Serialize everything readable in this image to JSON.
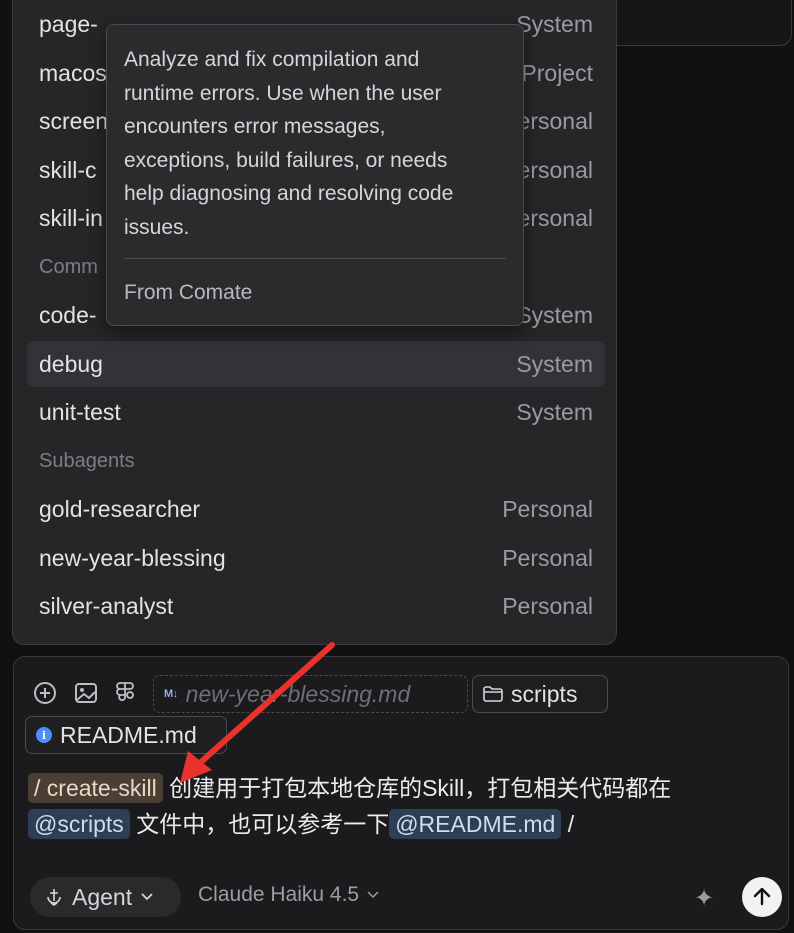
{
  "dropdown": {
    "rows_top": [
      {
        "name": "page-",
        "source": "System"
      },
      {
        "name": "macos",
        "source": "Project"
      },
      {
        "name": "screen",
        "source": "Personal"
      },
      {
        "name": "skill-c",
        "source": "Personal"
      },
      {
        "name": "skill-in",
        "source": "Personal"
      }
    ],
    "section_commands": "Comm",
    "commands": [
      {
        "name": "code-",
        "source": "System"
      },
      {
        "name": "debug",
        "source": "System"
      },
      {
        "name": "unit-test",
        "source": "System"
      }
    ],
    "section_subagents": "Subagents",
    "subagents": [
      {
        "name": "gold-researcher",
        "source": "Personal"
      },
      {
        "name": "new-year-blessing",
        "source": "Personal"
      },
      {
        "name": "silver-analyst",
        "source": "Personal"
      }
    ]
  },
  "tooltip": {
    "lines": [
      "Analyze and fix compilation and",
      "runtime errors. Use when the user",
      "encounters error messages,",
      "exceptions, build failures, or needs",
      "help diagnosing and resolving code",
      "issues."
    ],
    "from": "From Comate"
  },
  "composer": {
    "icons": [
      "add-circle-icon",
      "image-icon",
      "figma-icon"
    ],
    "context_chips": {
      "suggested_file": "new-year-blessing.md",
      "suggested_badge": "M↓",
      "folder": "scripts",
      "file": "README.md",
      "file_badge": "i"
    },
    "message": {
      "command": "/ create-skill",
      "text_1": "创建用于打包本地仓库的Skill，打包相关代码都在",
      "ref_1": "@scripts",
      "text_2": "文件中，也可以参考一下",
      "ref_2": "@README.md",
      "trailing": "/"
    },
    "mode": "Agent",
    "model": "Claude Haiku 4.5"
  },
  "colors": {
    "accent_arrow": "#e8322b",
    "info_badge": "#4c8ef7",
    "command_pill": "#4a3f35",
    "ref_pill": "#2e3f55"
  }
}
